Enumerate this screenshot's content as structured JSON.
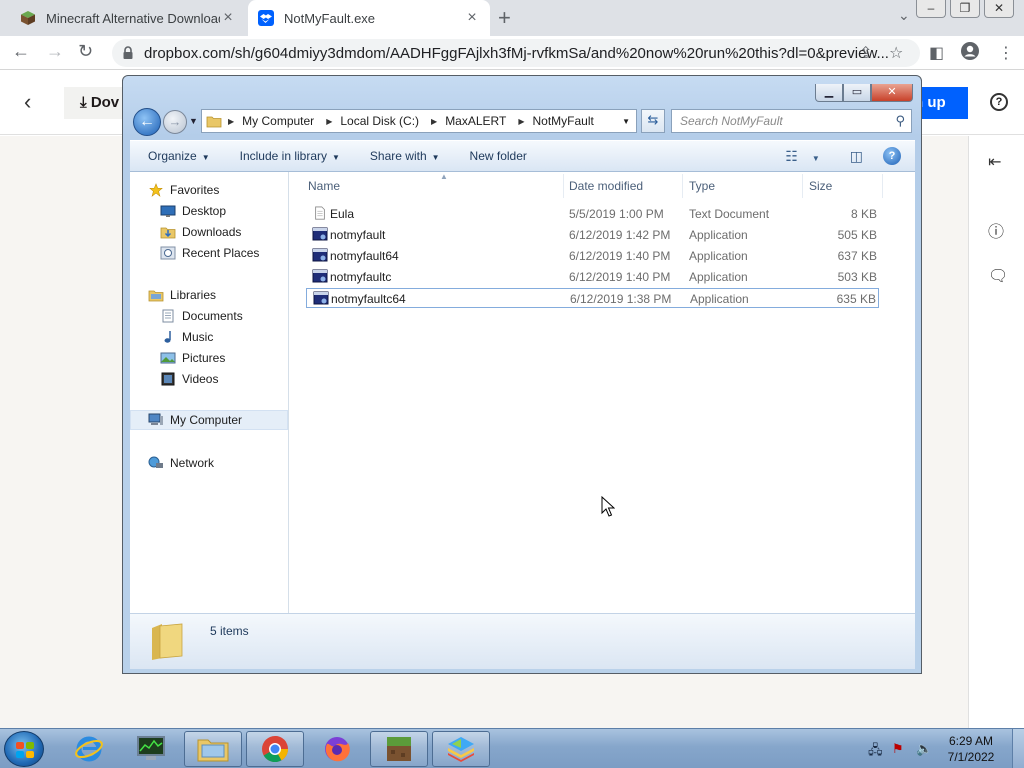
{
  "browser": {
    "tabs": [
      {
        "title": "Minecraft Alternative Downloads",
        "active": false
      },
      {
        "title": "NotMyFault.exe",
        "active": true
      }
    ],
    "new_tab": "+",
    "url": "dropbox.com/sh/g604dmiyy3dmdom/AADHFggFAjlxh3fMj-rvfkmSa/and%20now%20run%20this?dl=0&preview..."
  },
  "dropbox": {
    "download_label": "Dov",
    "signup_label": "n up",
    "help_label": "?"
  },
  "explorer": {
    "breadcrumb": [
      "My Computer",
      "Local Disk (C:)",
      "MaxALERT",
      "NotMyFault"
    ],
    "search_placeholder": "Search NotMyFault",
    "commands": {
      "organize": "Organize",
      "include": "Include in library",
      "share": "Share with",
      "new_folder": "New folder"
    },
    "nav": {
      "favorites": "Favorites",
      "desktop": "Desktop",
      "downloads": "Downloads",
      "recent": "Recent Places",
      "libraries": "Libraries",
      "documents": "Documents",
      "music": "Music",
      "pictures": "Pictures",
      "videos": "Videos",
      "computer": "My Computer",
      "network": "Network"
    },
    "columns": {
      "name": "Name",
      "date": "Date modified",
      "type": "Type",
      "size": "Size"
    },
    "files": [
      {
        "name": "Eula",
        "date": "5/5/2019 1:00 PM",
        "type": "Text Document",
        "size": "8 KB",
        "icon": "text-document-icon"
      },
      {
        "name": "notmyfault",
        "date": "6/12/2019 1:42 PM",
        "type": "Application",
        "size": "505 KB",
        "icon": "application-icon"
      },
      {
        "name": "notmyfault64",
        "date": "6/12/2019 1:40 PM",
        "type": "Application",
        "size": "637 KB",
        "icon": "application-icon"
      },
      {
        "name": "notmyfaultc",
        "date": "6/12/2019 1:40 PM",
        "type": "Application",
        "size": "503 KB",
        "icon": "application-icon"
      },
      {
        "name": "notmyfaultc64",
        "date": "6/12/2019 1:38 PM",
        "type": "Application",
        "size": "635 KB",
        "icon": "application-icon"
      }
    ],
    "selected_file": "notmyfaultc64",
    "item_count": "5 items"
  },
  "taskbar": {
    "time": "6:29 AM",
    "date": "7/1/2022"
  },
  "colors": {
    "dropbox_blue": "#0061fe",
    "explorer_frame": "#b9d1ea",
    "taskbar": "#86a6cb"
  }
}
